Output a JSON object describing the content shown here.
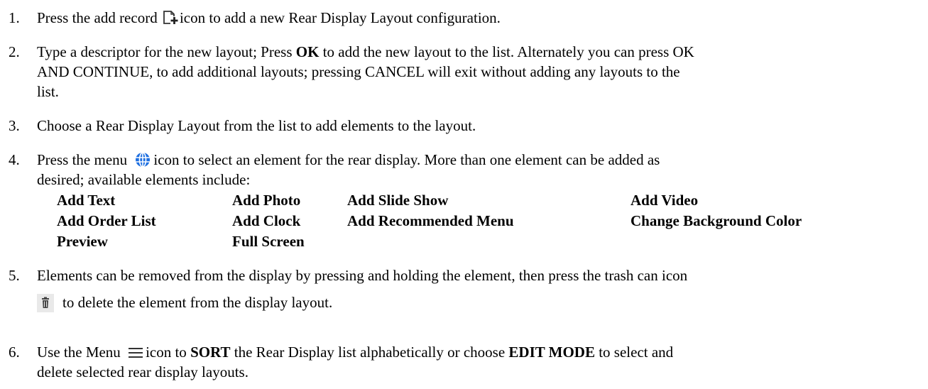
{
  "steps": [
    {
      "number": "1.",
      "parts": {
        "a": "Press the add record ",
        "b": "icon to add a new Rear Display Layout configuration."
      }
    },
    {
      "number": "2.",
      "parts": {
        "a": "Type a descriptor for the new layout; Press ",
        "ok": "OK",
        "b": " to add the new layout to the list. Alternately you can press OK",
        "c": "AND CONTINUE, to add additional layouts; pressing CANCEL will exit without adding any layouts to the",
        "d": "list."
      }
    },
    {
      "number": "3.",
      "parts": {
        "a": "Choose a Rear Display Layout from the list to add elements to the layout."
      }
    },
    {
      "number": "4.",
      "parts": {
        "a": "Press the menu ",
        "b": "icon to select an element for the rear display. More than one element can be added as",
        "c": "desired; available elements include:"
      },
      "elements": [
        "Add Text",
        "Add Photo",
        "Add Slide Show",
        "Add Video",
        "Add Order List",
        "Add Clock",
        "Add Recommended Menu",
        "Change Background Color",
        "Preview",
        "Full Screen"
      ]
    },
    {
      "number": "5.",
      "parts": {
        "a": "Elements can be removed from the display by pressing and holding the element, then press the trash can icon",
        "b": "to delete the element from the display layout."
      }
    },
    {
      "number": "6.",
      "parts": {
        "a": "Use the Menu ",
        "b": "icon to ",
        "sort": "SORT",
        "c": " the Rear Display list alphabetically or choose ",
        "edit": "EDIT MODE",
        "d": " to select and",
        "e": "delete selected rear display layouts."
      }
    }
  ],
  "icons": {
    "add_record": "add-record-icon",
    "menu_globe": "globe-menu-icon",
    "trash": "trash-can-icon",
    "hamburger": "hamburger-menu-icon"
  },
  "colors": {
    "globe": "#1e6fe0",
    "trash_bg": "#e9e9e9"
  }
}
